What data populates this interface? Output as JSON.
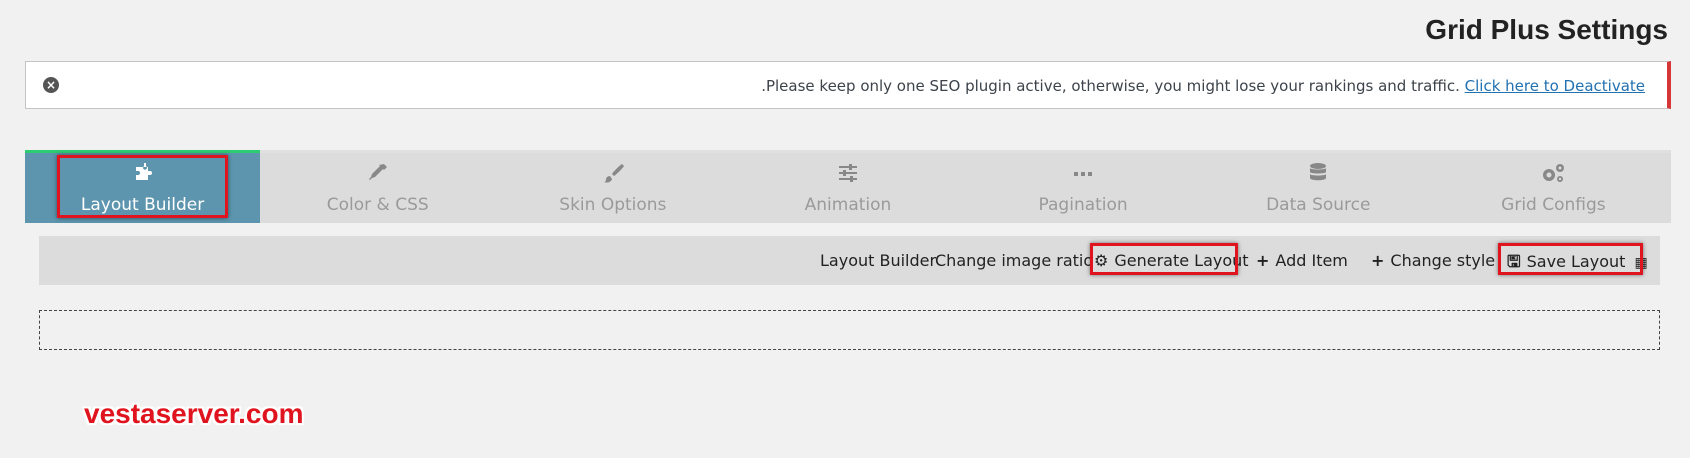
{
  "page": {
    "title": "Grid Plus Settings"
  },
  "notice": {
    "dismiss_icon": "close-circle-icon",
    "text": ".Please keep only one SEO plugin active, otherwise, you might lose your rankings and traffic.",
    "link": "Click here to Deactivate",
    "border_color": "#d63638"
  },
  "tabs": [
    {
      "label": "Layout Builder",
      "icon": "puzzle-icon",
      "active": true
    },
    {
      "label": "Color & CSS",
      "icon": "eyedropper-icon",
      "active": false
    },
    {
      "label": "Skin Options",
      "icon": "brush-icon",
      "active": false
    },
    {
      "label": "Animation",
      "icon": "sliders-icon",
      "active": false
    },
    {
      "label": "Pagination",
      "icon": "dots-icon",
      "active": false
    },
    {
      "label": "Data Source",
      "icon": "database-icon",
      "active": false
    },
    {
      "label": "Grid Configs",
      "icon": "gears-icon",
      "active": false
    }
  ],
  "toolbar": {
    "layout_builder": "Layout Builder",
    "change_image_ratio": "Change image ratio",
    "generate_layout": "Generate Layout",
    "add_item": "Add Item",
    "change_style": "Change style",
    "save_layout": "Save Layout"
  },
  "watermark": "vestaserver.com",
  "colors": {
    "active_tab": "#5d95ae",
    "active_tab_top": "#2ecc71",
    "highlight": "#e0141e"
  }
}
